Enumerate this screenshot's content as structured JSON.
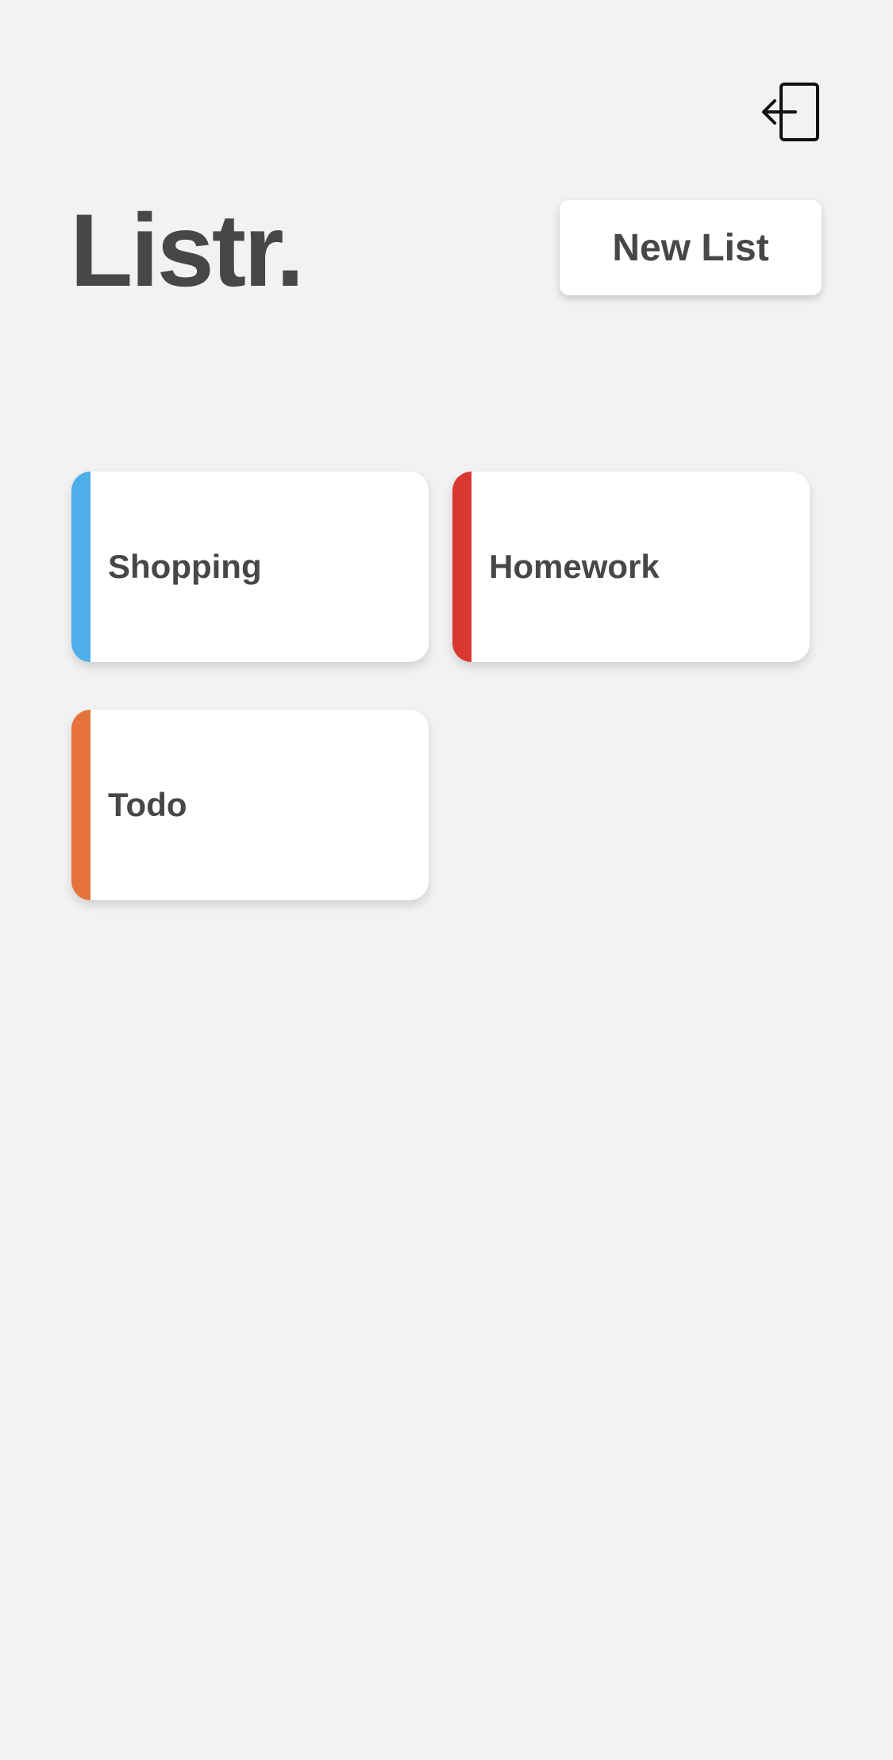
{
  "header": {
    "title": "Listr.",
    "new_list_label": "New List",
    "logout_icon": "logout-icon"
  },
  "lists": [
    {
      "name": "Shopping",
      "color": "#4eaeea"
    },
    {
      "name": "Homework",
      "color": "#d9382f"
    },
    {
      "name": "Todo",
      "color": "#e6733a"
    }
  ],
  "colors": {
    "background": "#f2f2f2",
    "text": "#474747",
    "card": "#ffffff"
  }
}
